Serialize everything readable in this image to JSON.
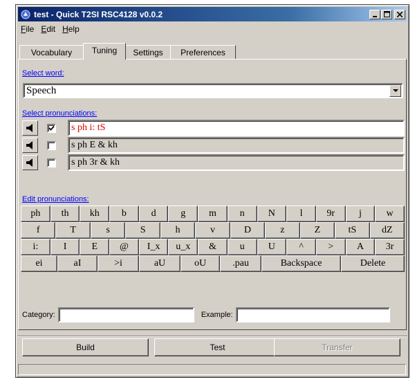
{
  "window": {
    "title": "test - Quick T2SI RSC4128 v0.0.2"
  },
  "menu": [
    {
      "label": "File",
      "key": "F",
      "rest": "ile"
    },
    {
      "label": "Edit",
      "key": "E",
      "rest": "dit"
    },
    {
      "label": "Help",
      "key": "H",
      "rest": "elp"
    }
  ],
  "tabs": [
    {
      "label": "Vocabulary",
      "active": false
    },
    {
      "label": "Tuning",
      "active": true
    },
    {
      "label": "Settings",
      "active": false
    },
    {
      "label": "Preferences",
      "active": false
    }
  ],
  "tuning": {
    "select_word_label": "Select word:",
    "selected_word": "Speech",
    "select_pron_label": "Select pronunciations:",
    "pronunciations": [
      {
        "text": "s ph i: tS",
        "checked": true,
        "selected": true
      },
      {
        "text": "s ph E & kh",
        "checked": false,
        "selected": false
      },
      {
        "text": "s ph 3r & kh",
        "checked": false,
        "selected": false
      }
    ],
    "edit_pron_label": "Edit pronunciations:",
    "keyboard_rows": [
      [
        "ph",
        "th",
        "kh",
        "b",
        "d",
        "g",
        "m",
        "n",
        "N",
        "l",
        "9r",
        "j",
        "w"
      ],
      [
        "f",
        "T",
        "s",
        "S",
        "h",
        "v",
        "D",
        "z",
        "Z",
        "tS",
        "dZ"
      ],
      [
        "i:",
        "I",
        "E",
        "@",
        "I_x",
        "u_x",
        "&",
        "u",
        "U",
        "^",
        ">",
        "A",
        "3r"
      ],
      [
        "ei",
        "aI",
        ">i",
        "aU",
        "oU",
        ".pau",
        "Backspace",
        "Delete"
      ]
    ],
    "category_label": "Category:",
    "category_value": "",
    "example_label": "Example:",
    "example_value": ""
  },
  "actions": {
    "build": "Build",
    "test": "Test",
    "transfer": "Transfer"
  },
  "status": ""
}
